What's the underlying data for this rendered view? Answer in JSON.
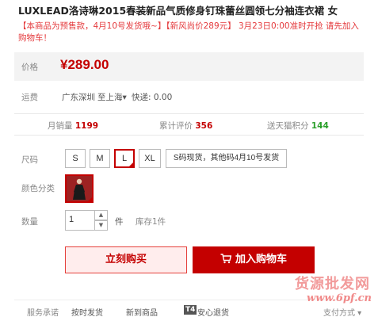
{
  "product": {
    "title": "LUXLEAD洛诗琳2015春装新品气质修身钉珠蕾丝圆领七分袖连衣裙 女",
    "promo": "【本商品为预售款，4月10号发货哦~】【新风尚价289元】 3月23日0:00准时开抢 请先加入购物车！"
  },
  "price": {
    "label": "价格",
    "value": "¥289.00"
  },
  "shipping": {
    "label": "运费",
    "origin": "广东深圳",
    "destination": "至上海▾",
    "fee": "快递: 0.00"
  },
  "stats": {
    "monthly_sales_label": "月销量",
    "monthly_sales": "1199",
    "reviews_label": "累计评价",
    "reviews": "356",
    "points_label": "送天猫积分",
    "points": "144"
  },
  "options": {
    "size_label": "尺码",
    "sizes": [
      "S",
      "M",
      "L",
      "XL",
      "S码现货，其他码4月10号发货"
    ],
    "selected_size": "L",
    "color_label": "颜色分类",
    "quantity_label": "数量",
    "quantity": "1",
    "unit": "件",
    "stock": "库存1件"
  },
  "actions": {
    "buy_now": "立刻购买",
    "add_to_cart": "加入购物车"
  },
  "footer": {
    "label": "服务承诺",
    "items": [
      "按时发货",
      "新到商品",
      "安心退货"
    ],
    "badge": "T4",
    "payment": "支付方式 ▾"
  },
  "watermark": {
    "line1": "货源批发网",
    "line2": "www.6pf.cn"
  },
  "colors": {
    "accent": "#c40000",
    "points_green": "#2a9f2a",
    "price_bg": "#f3f3f3"
  }
}
